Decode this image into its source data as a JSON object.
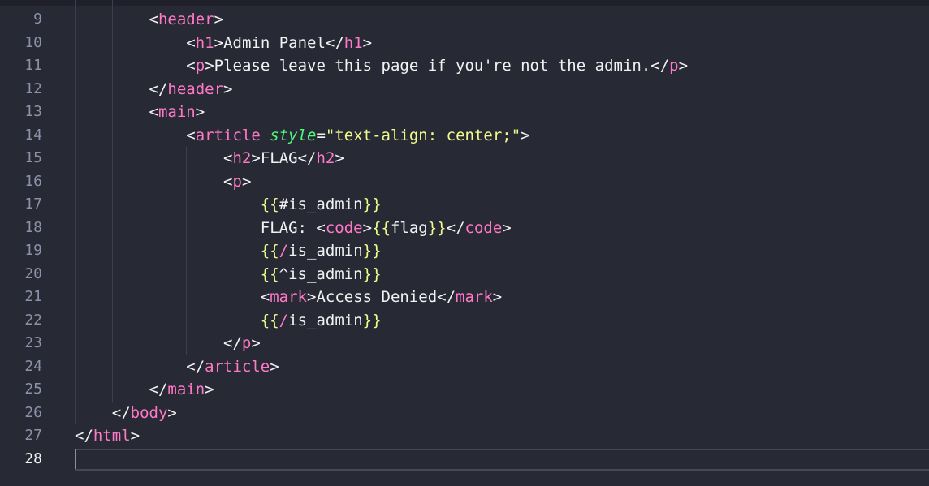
{
  "editor": {
    "current_line": "28",
    "lines": [
      {
        "num": "9",
        "indent": "        ",
        "tokens": [
          [
            "p",
            "<"
          ],
          [
            "tag",
            "header"
          ],
          [
            "p",
            ">"
          ]
        ]
      },
      {
        "num": "10",
        "indent": "            ",
        "tokens": [
          [
            "p",
            "<"
          ],
          [
            "tag",
            "h1"
          ],
          [
            "p",
            ">Admin Panel</"
          ],
          [
            "tag",
            "h1"
          ],
          [
            "p",
            ">"
          ]
        ]
      },
      {
        "num": "11",
        "indent": "            ",
        "tokens": [
          [
            "p",
            "<"
          ],
          [
            "tag",
            "p"
          ],
          [
            "p",
            ">Please leave this page if you're not the admin.</"
          ],
          [
            "tag",
            "p"
          ],
          [
            "p",
            ">"
          ]
        ]
      },
      {
        "num": "12",
        "indent": "        ",
        "tokens": [
          [
            "p",
            "</"
          ],
          [
            "tag",
            "header"
          ],
          [
            "p",
            ">"
          ]
        ]
      },
      {
        "num": "13",
        "indent": "        ",
        "tokens": [
          [
            "p",
            "<"
          ],
          [
            "tag",
            "main"
          ],
          [
            "p",
            ">"
          ]
        ]
      },
      {
        "num": "14",
        "indent": "            ",
        "tokens": [
          [
            "p",
            "<"
          ],
          [
            "tag",
            "article"
          ],
          [
            "p",
            " "
          ],
          [
            "attr",
            "style"
          ],
          [
            "p",
            "="
          ],
          [
            "str",
            "\"text-align: center;\""
          ],
          [
            "p",
            ">"
          ]
        ]
      },
      {
        "num": "15",
        "indent": "                ",
        "tokens": [
          [
            "p",
            "<"
          ],
          [
            "tag",
            "h2"
          ],
          [
            "p",
            ">FLAG</"
          ],
          [
            "tag",
            "h2"
          ],
          [
            "p",
            ">"
          ]
        ]
      },
      {
        "num": "16",
        "indent": "                ",
        "tokens": [
          [
            "p",
            "<"
          ],
          [
            "tag",
            "p"
          ],
          [
            "p",
            ">"
          ]
        ]
      },
      {
        "num": "17",
        "indent": "                    ",
        "tokens": [
          [
            "brace",
            "{{"
          ],
          [
            "p",
            "#is_admin"
          ],
          [
            "brace",
            "}}"
          ]
        ]
      },
      {
        "num": "18",
        "indent": "                    ",
        "tokens": [
          [
            "p",
            "FLAG: <"
          ],
          [
            "tag",
            "code"
          ],
          [
            "p",
            ">"
          ],
          [
            "brace",
            "{{"
          ],
          [
            "p",
            "flag"
          ],
          [
            "brace",
            "}}"
          ],
          [
            "p",
            "</"
          ],
          [
            "tag",
            "code"
          ],
          [
            "p",
            ">"
          ]
        ]
      },
      {
        "num": "19",
        "indent": "                    ",
        "tokens": [
          [
            "brace",
            "{{"
          ],
          [
            "tag",
            "/"
          ],
          [
            "p",
            "is_admin"
          ],
          [
            "brace",
            "}}"
          ]
        ]
      },
      {
        "num": "20",
        "indent": "                    ",
        "tokens": [
          [
            "brace",
            "{{"
          ],
          [
            "p",
            "^is_admin"
          ],
          [
            "brace",
            "}}"
          ]
        ]
      },
      {
        "num": "21",
        "indent": "                    ",
        "tokens": [
          [
            "p",
            "<"
          ],
          [
            "tag",
            "mark"
          ],
          [
            "p",
            ">Access Denied</"
          ],
          [
            "tag",
            "mark"
          ],
          [
            "p",
            ">"
          ]
        ]
      },
      {
        "num": "22",
        "indent": "                    ",
        "tokens": [
          [
            "brace",
            "{{"
          ],
          [
            "tag",
            "/"
          ],
          [
            "p",
            "is_admin"
          ],
          [
            "brace",
            "}}"
          ]
        ]
      },
      {
        "num": "23",
        "indent": "                ",
        "tokens": [
          [
            "p",
            "</"
          ],
          [
            "tag",
            "p"
          ],
          [
            "p",
            ">"
          ]
        ]
      },
      {
        "num": "24",
        "indent": "            ",
        "tokens": [
          [
            "p",
            "</"
          ],
          [
            "tag",
            "article"
          ],
          [
            "p",
            ">"
          ]
        ]
      },
      {
        "num": "25",
        "indent": "        ",
        "tokens": [
          [
            "p",
            "</"
          ],
          [
            "tag",
            "main"
          ],
          [
            "p",
            ">"
          ]
        ]
      },
      {
        "num": "26",
        "indent": "    ",
        "tokens": [
          [
            "p",
            "</"
          ],
          [
            "tag",
            "body"
          ],
          [
            "p",
            ">"
          ]
        ]
      },
      {
        "num": "27",
        "indent": "",
        "tokens": [
          [
            "p",
            "</"
          ],
          [
            "tag",
            "html"
          ],
          [
            "p",
            ">"
          ]
        ]
      },
      {
        "num": "28",
        "indent": "",
        "tokens": []
      }
    ]
  },
  "colors": {
    "background": "#272935",
    "tag": "#ff79c6",
    "attribute": "#50fa7b",
    "string": "#f1fa8c",
    "text": "#f2f2f2",
    "line_number": "#8c90a8"
  }
}
